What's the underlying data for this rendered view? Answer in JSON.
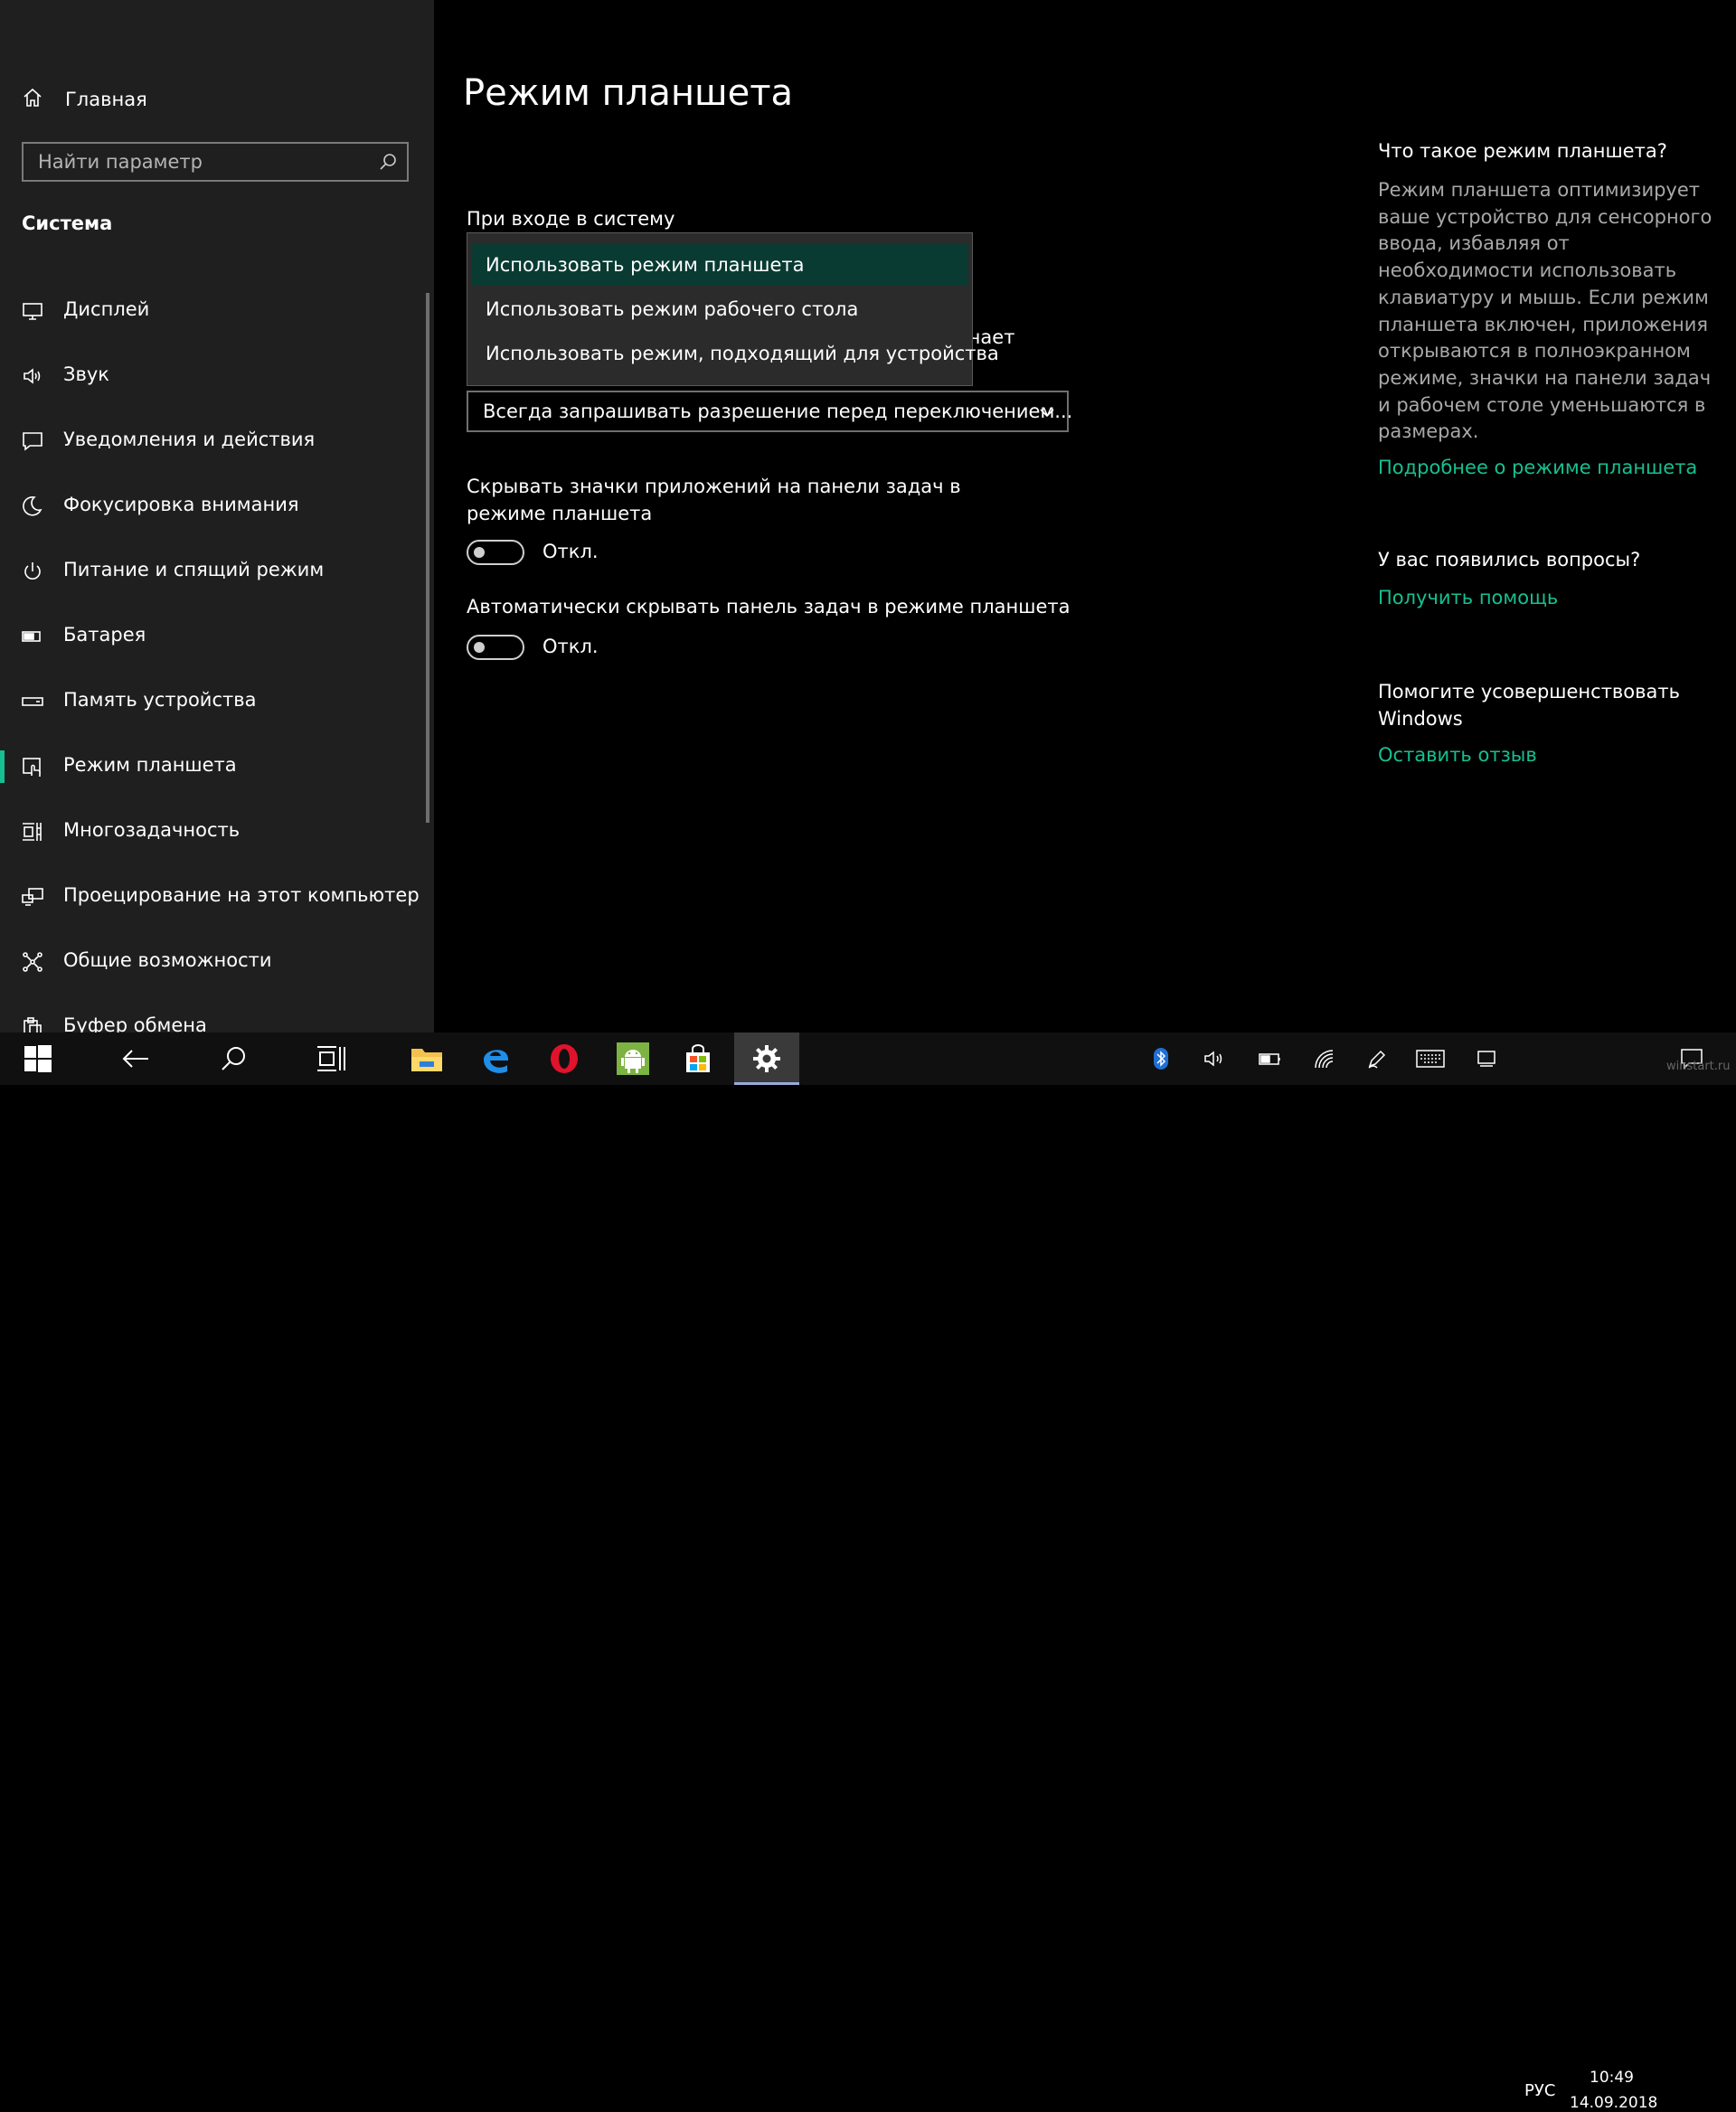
{
  "sidebar": {
    "home_label": "Главная",
    "search_placeholder": "Найти параметр",
    "section_heading": "Система",
    "items": [
      {
        "label": "Дисплей",
        "icon": "display-icon"
      },
      {
        "label": "Звук",
        "icon": "speaker-icon"
      },
      {
        "label": "Уведомления и действия",
        "icon": "notification-icon"
      },
      {
        "label": "Фокусировка внимания",
        "icon": "moon-icon"
      },
      {
        "label": "Питание и спящий режим",
        "icon": "power-icon"
      },
      {
        "label": "Батарея",
        "icon": "battery-icon"
      },
      {
        "label": "Память устройства",
        "icon": "storage-icon"
      },
      {
        "label": "Режим планшета",
        "icon": "tablet-mode-icon",
        "selected": true
      },
      {
        "label": "Многозадачность",
        "icon": "multitasking-icon"
      },
      {
        "label": "Проецирование на этот компьютер",
        "icon": "projecting-icon"
      },
      {
        "label": "Общие возможности",
        "icon": "shared-experiences-icon"
      },
      {
        "label": "Буфер обмена",
        "icon": "clipboard-icon"
      }
    ]
  },
  "main": {
    "title": "Режим планшета",
    "signin_label": "При входе в систему",
    "signin_options": [
      "Использовать режим планшета",
      "Использовать режим рабочего стола",
      "Использовать режим, подходящий для устройства"
    ],
    "signin_selected_index": 0,
    "switch_label_visible_tail": "чает",
    "switch_combo_value": "Всегда запрашивать разрешение перед переключением...",
    "hide_icons_label": "Скрывать значки приложений на панели задач в режиме планшета",
    "hide_icons_state": "Откл.",
    "autohide_label": "Автоматически скрывать панель задач в режиме планшета",
    "autohide_state": "Откл."
  },
  "help": {
    "about_heading": "Что такое режим планшета?",
    "about_text": "Режим планшета оптимизирует ваше устройство для сенсорного ввода, избавляя от необходимости использовать клавиатуру и мышь. Если режим планшета включен, приложения открываются в полноэкранном режиме, значки на панели задач и рабочем столе уменьшаются в размерах.",
    "about_link": "Подробнее о режиме планшета",
    "questions_heading": "У вас появились вопросы?",
    "questions_link": "Получить помощь",
    "improve_heading": "Помогите усовершенствовать Windows",
    "improve_link": "Оставить отзыв"
  },
  "taskbar": {
    "language": "РУС",
    "time": "10:49",
    "date": "14.09.2018",
    "watermark": "winstart.ru"
  },
  "colors": {
    "accent": "#16c090",
    "sidebar_bg": "#1f1f1f",
    "selected_option_bg": "#093b33"
  }
}
